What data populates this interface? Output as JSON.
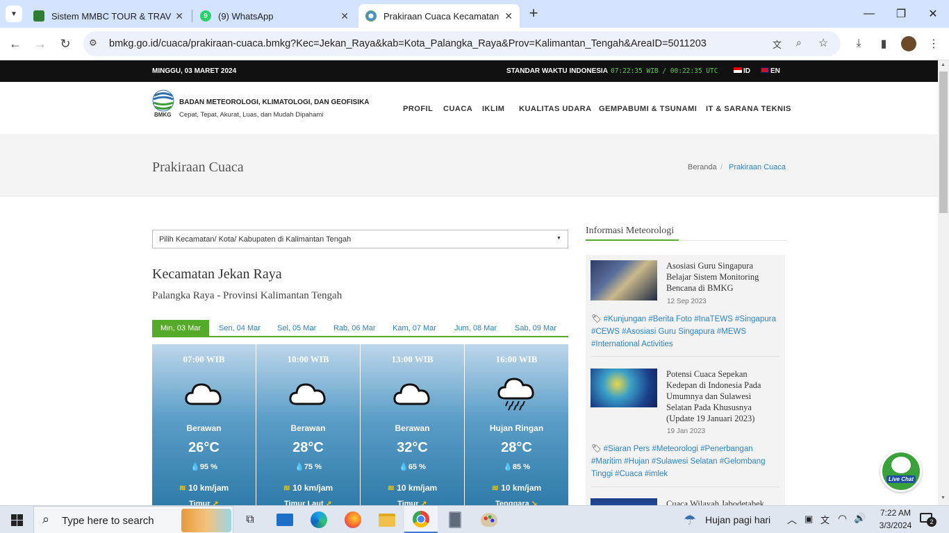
{
  "browser": {
    "tabs": [
      {
        "title": "Sistem MMBC TOUR & TRAVEL",
        "favicon_color": "#2e7d32"
      },
      {
        "title": "(9) WhatsApp",
        "favicon_color": "#25d366",
        "badge": "9"
      },
      {
        "title": "Prakiraan Cuaca Kecamatan Jek",
        "favicon_color": "#4a90c9"
      }
    ],
    "new_tab": "+",
    "url": "bmkg.go.id/cuaca/prakiraan-cuaca.bmkg?Kec=Jekan_Raya&kab=Kota_Palangka_Raya&Prov=Kalimantan_Tengah&AreaID=5011203"
  },
  "topbar": {
    "date": "MINGGU, 03 MARET 2024",
    "time_label": "STANDAR WAKTU INDONESIA",
    "time_value": "07:22:35 WIB / 00:22:35 UTC",
    "lang_id": "ID",
    "lang_en": "EN"
  },
  "header": {
    "logo_text": "BMKG",
    "org_name": "BADAN METEOROLOGI, KLIMATOLOGI, DAN GEOFISIKA",
    "tagline": "Cepat, Tepat, Akurat, Luas, dan Mudah Dipahami",
    "nav": [
      "PROFIL",
      "CUACA",
      "IKLIM",
      "KUALITAS UDARA",
      "GEMPABUMI & TSUNAMI",
      "IT & SARANA TEKNIS"
    ]
  },
  "titlebar": {
    "title": "Prakiraan Cuaca",
    "breadcrumb_home": "Beranda",
    "breadcrumb_sep": "/",
    "breadcrumb_current": "Prakiraan Cuaca"
  },
  "main": {
    "select_placeholder": "Pilih Kecamatan/ Kota/ Kabupaten di Kalimantan Tengah",
    "location_title": "Kecamatan Jekan Raya",
    "location_sub": "Palangka Raya - Provinsi Kalimantan Tengah",
    "day_tabs": [
      "Min, 03 Mar",
      "Sen, 04 Mar",
      "Sel, 05 Mar",
      "Rab, 06 Mar",
      "Kam, 07 Mar",
      "Jum, 08 Mar",
      "Sab, 09 Mar"
    ],
    "forecasts": [
      {
        "time": "07:00 WIB",
        "condition": "Berawan",
        "temp": "26°C",
        "humidity": "95 %",
        "wind": "10 km/jam",
        "direction": "Timur",
        "icon": "cloud-icon"
      },
      {
        "time": "10:00 WIB",
        "condition": "Berawan",
        "temp": "28°C",
        "humidity": "75 %",
        "wind": "10 km/jam",
        "direction": "Timur Laut",
        "icon": "cloud-icon"
      },
      {
        "time": "13:00 WIB",
        "condition": "Berawan",
        "temp": "32°C",
        "humidity": "65 %",
        "wind": "10 km/jam",
        "direction": "Timur",
        "icon": "cloud-icon"
      },
      {
        "time": "16:00 WIB",
        "condition": "Hujan Ringan",
        "temp": "28°C",
        "humidity": "85 %",
        "wind": "10 km/jam",
        "direction": "Tenggara",
        "icon": "rain-cloud-icon"
      }
    ]
  },
  "sidebar": {
    "heading": "Informasi Meteorologi",
    "news": [
      {
        "title": "Asosiasi Guru Singapura Belajar Sistem Monitoring Bencana di BMKG",
        "date": "12 Sep 2023",
        "tags": "#Kunjungan #Berita Foto #InaTEWS #Singapura #CEWS #Asosiasi Guru Singapura #MEWS #International Activities"
      },
      {
        "title": "Potensi Cuaca Sepekan Kedepan di Indonesia Pada Umumnya dan Sulawesi Selatan Pada Khususnya (Update 19 Januari 2023)",
        "date": "19 Jan 2023",
        "tags": "#Siaran Pers #Meteorologi #Penerbangan #Maritim #Hujan #Sulawesi Selatan #Gelombang Tinggi #Cuaca #imlek"
      },
      {
        "title": "Cuaca Wilayah Jabodetabek"
      }
    ],
    "livechat": "Live Chat"
  },
  "taskbar": {
    "search_placeholder": "Type here to search",
    "weather": "Hujan pagi hari",
    "time": "7:22 AM",
    "date": "3/3/2024",
    "notification_count": "2"
  }
}
